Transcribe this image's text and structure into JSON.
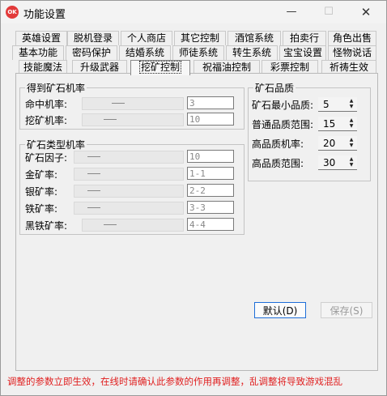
{
  "window": {
    "title": "功能设置",
    "app_icon_text": "OK",
    "minimize": "—",
    "maximize": "☐",
    "close": "✕"
  },
  "tabs": {
    "row1": [
      "英雄设置",
      "脱机登录",
      "个人商店",
      "其它控制",
      "酒馆系统",
      "拍卖行",
      "角色出售"
    ],
    "row2": [
      "基本功能",
      "密码保护",
      "结婚系统",
      "师徒系统",
      "转生系统",
      "宝宝设置",
      "怪物说话"
    ],
    "row3": [
      "技能魔法",
      "升级武器",
      "挖矿控制",
      "祝福油控制",
      "彩票控制",
      "祈祷生效"
    ],
    "active": "挖矿控制"
  },
  "ore_rate": {
    "title": "得到矿石机率",
    "rows": [
      {
        "label": "命中机率:",
        "value": "3"
      },
      {
        "label": "挖矿机率:",
        "value": "10"
      }
    ]
  },
  "ore_type": {
    "title": "矿石类型机率",
    "rows": [
      {
        "label": "矿石因子:",
        "value": "10"
      },
      {
        "label": "金矿率:",
        "value": "1-1"
      },
      {
        "label": "银矿率:",
        "value": "2-2"
      },
      {
        "label": "铁矿率:",
        "value": "3-3"
      },
      {
        "label": "黑铁矿率:",
        "value": "4-4"
      }
    ]
  },
  "ore_quality": {
    "title": "矿石品质",
    "rows": [
      {
        "label": "矿石最小品质:",
        "value": "5"
      },
      {
        "label": "普通品质范围:",
        "value": "15"
      },
      {
        "label": "高品质机率:",
        "value": "20"
      },
      {
        "label": "高品质范围:",
        "value": "30"
      }
    ]
  },
  "buttons": {
    "default": "默认(D)",
    "save": "保存(S)"
  },
  "warning": "调整的参数立即生效，在线时请确认此参数的作用再调整，乱调整将导致游戏混乱"
}
